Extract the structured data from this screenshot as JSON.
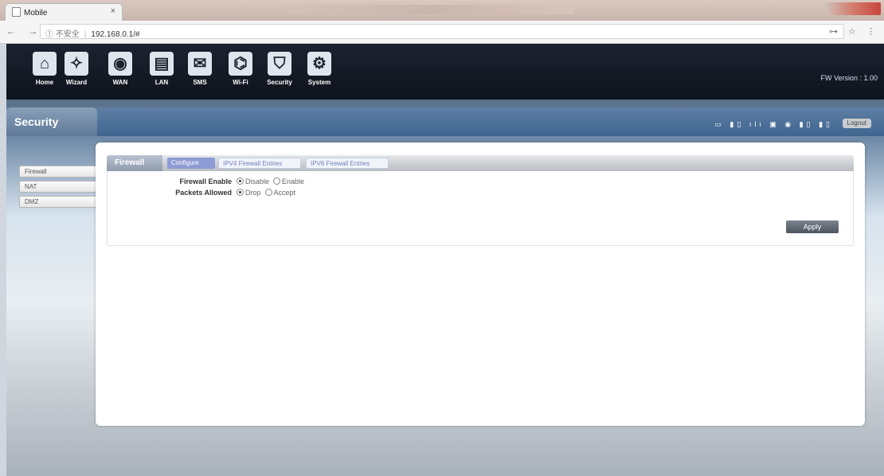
{
  "browser": {
    "tab_title": "Mobile",
    "tab_close": "×",
    "address_security": "① 不安全",
    "address_sep": "|",
    "address_url": "192.168.0.1/#",
    "nav_glyphs": "← → C",
    "right_glyphs": "⊶ ☆ ⋮"
  },
  "topnav": {
    "items": [
      {
        "label": "Home",
        "icon": "home-icon",
        "glyph": "⌂"
      },
      {
        "label": "Wizard",
        "icon": "wizard-icon",
        "glyph": "✧"
      },
      {
        "label": "WAN",
        "icon": "wan-icon",
        "glyph": "◉"
      },
      {
        "label": "LAN",
        "icon": "lan-icon",
        "glyph": "▤"
      },
      {
        "label": "SMS",
        "icon": "sms-icon",
        "glyph": "✉"
      },
      {
        "label": "Wi-Fi",
        "icon": "wifi-icon",
        "glyph": "⌬"
      },
      {
        "label": "Security",
        "icon": "security-icon",
        "glyph": "⛉"
      },
      {
        "label": "System",
        "icon": "system-icon",
        "glyph": "⚙"
      }
    ],
    "fw_version": "FW Version : 1.00"
  },
  "section": {
    "title": "Security",
    "status_glyphs": "▭ ▮▯ ılı ▣ ◉ ▮▯ ▮▯",
    "logout_label": "Logout"
  },
  "side_menu": {
    "items": [
      {
        "label": "Firewall"
      },
      {
        "label": "NAT"
      },
      {
        "label": "DMZ"
      }
    ]
  },
  "panel": {
    "header": "Firewall",
    "tabs": [
      {
        "label": "Configure"
      },
      {
        "label": "IPV4 Firewall Entries"
      },
      {
        "label": "IPV6 Firewall Entries"
      }
    ],
    "firewall_enable": {
      "label": "Firewall Enable",
      "options": [
        "Disable",
        "Enable"
      ],
      "selected": "Disable"
    },
    "packets_allowed": {
      "label": "Packets Allowed",
      "options": [
        "Drop",
        "Accept"
      ],
      "selected": "Drop"
    },
    "apply_label": "Apply"
  },
  "colors": {
    "nav_bg": "#0e131c",
    "tab_active": "#8f9bd4",
    "apply_bg": "#4d5561"
  }
}
